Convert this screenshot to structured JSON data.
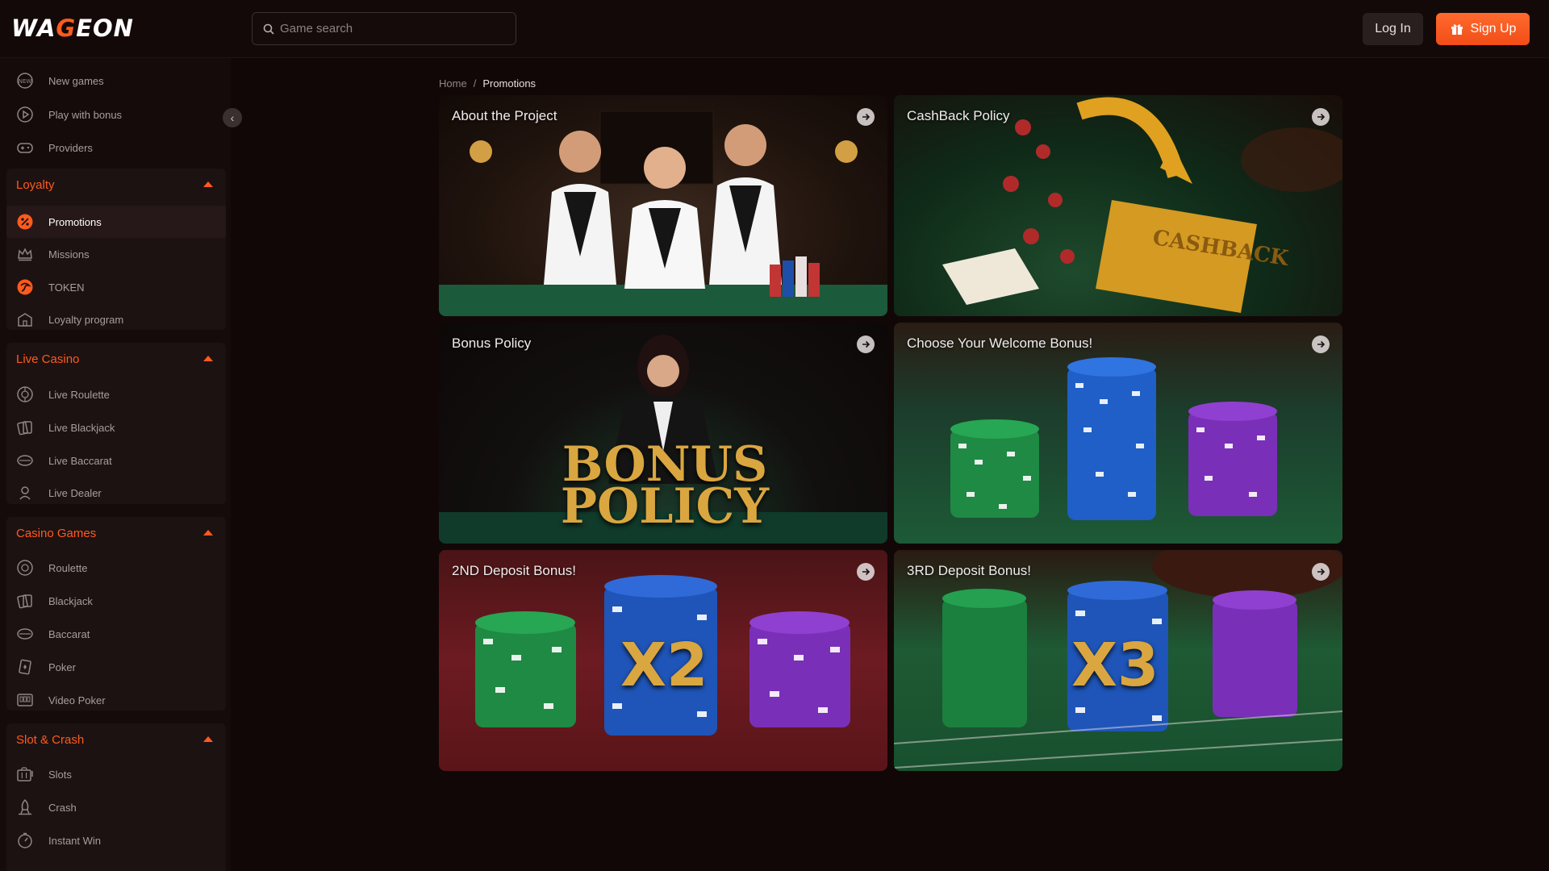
{
  "header": {
    "logo_text_pre": "WA",
    "logo_text_g": "G",
    "logo_text_post": "EON",
    "search_placeholder": "Game search",
    "login_label": "Log In",
    "signup_label": "Sign Up"
  },
  "sidebar": {
    "top_items": [
      {
        "label": "New games",
        "icon": "new-icon"
      },
      {
        "label": "Play with bonus",
        "icon": "play-icon"
      },
      {
        "label": "Providers",
        "icon": "gamepad-icon"
      }
    ],
    "groups": [
      {
        "title": "Loyalty",
        "items": [
          {
            "label": "Promotions",
            "icon": "promotions-icon"
          },
          {
            "label": "Missions",
            "icon": "crown-icon"
          },
          {
            "label": "TOKEN",
            "icon": "token-icon"
          },
          {
            "label": "Loyalty program",
            "icon": "building-icon"
          }
        ]
      },
      {
        "title": "Live Casino",
        "items": [
          {
            "label": "Live Roulette",
            "icon": "roulette-icon"
          },
          {
            "label": "Live Blackjack",
            "icon": "cards-icon"
          },
          {
            "label": "Live Baccarat",
            "icon": "baccarat-icon"
          },
          {
            "label": "Live Dealer",
            "icon": "dealer-icon"
          }
        ]
      },
      {
        "title": "Casino Games",
        "items": [
          {
            "label": "Roulette",
            "icon": "roulette-icon"
          },
          {
            "label": "Blackjack",
            "icon": "cards-icon"
          },
          {
            "label": "Baccarat",
            "icon": "baccarat-icon"
          },
          {
            "label": "Poker",
            "icon": "poker-icon"
          },
          {
            "label": "Video Poker",
            "icon": "video-poker-icon"
          }
        ]
      },
      {
        "title": "Slot & Crash",
        "items": [
          {
            "label": "Slots",
            "icon": "slots-icon"
          },
          {
            "label": "Crash",
            "icon": "crash-icon"
          },
          {
            "label": "Instant Win",
            "icon": "stopwatch-icon"
          }
        ]
      }
    ]
  },
  "breadcrumb": {
    "home": "Home",
    "separator": "/",
    "current": "Promotions"
  },
  "promotions": [
    {
      "title": "About the Project"
    },
    {
      "title": "CashBack Policy",
      "badge": "CASHBACK"
    },
    {
      "title": "Bonus Policy",
      "line1": "BONUS",
      "line2": "POLICY"
    },
    {
      "title": "Choose Your Welcome Bonus!"
    },
    {
      "title": "2ND Deposit Bonus!",
      "badge": "X2"
    },
    {
      "title": "3RD Deposit Bonus!",
      "badge": "X3"
    }
  ],
  "colors": {
    "accent": "#ff5a1f",
    "background": "#120707",
    "sidebar": "#160b0b"
  }
}
